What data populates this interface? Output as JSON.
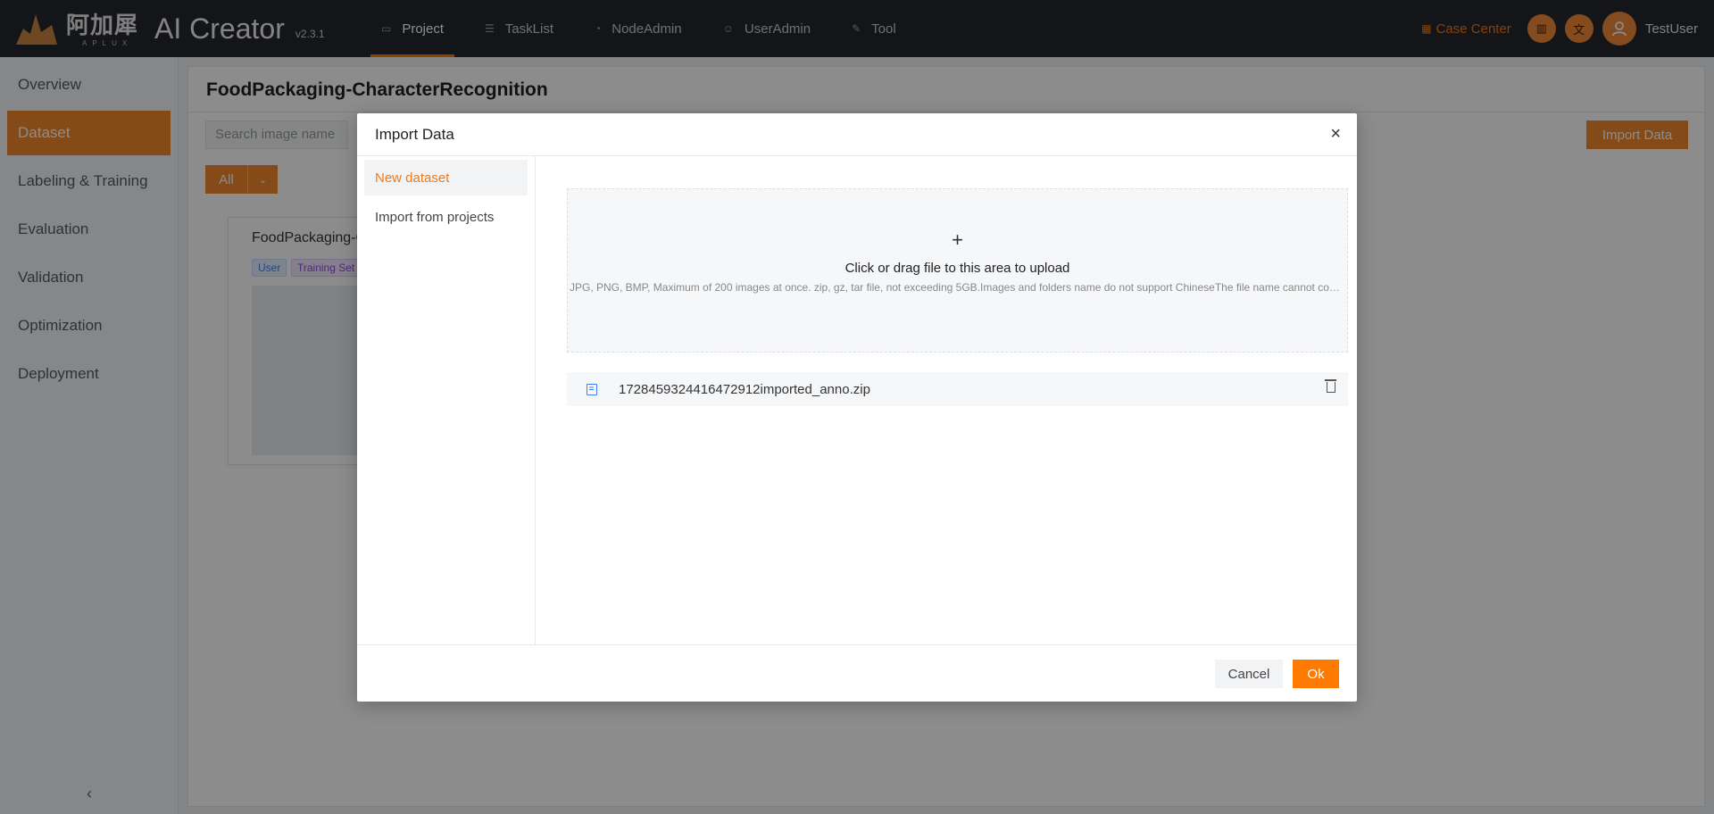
{
  "app": {
    "logo_cn": "阿加犀",
    "logo_sub": "APLUX",
    "title": "AI Creator",
    "version": "v2.3.1"
  },
  "nav": {
    "items": [
      {
        "label": "Project",
        "icon": "folder-icon",
        "active": true
      },
      {
        "label": "TaskList",
        "icon": "list-icon",
        "active": false
      },
      {
        "label": "NodeAdmin",
        "icon": "node-icon",
        "active": false
      },
      {
        "label": "UserAdmin",
        "icon": "users-icon",
        "active": false
      },
      {
        "label": "Tool",
        "icon": "wrench-icon",
        "active": false
      }
    ]
  },
  "topright": {
    "case_center": "Case Center",
    "user_name": "TestUser"
  },
  "sidebar": {
    "items": [
      {
        "label": "Overview",
        "active": false
      },
      {
        "label": "Dataset",
        "active": true
      },
      {
        "label": "Labeling & Training",
        "active": false
      },
      {
        "label": "Evaluation",
        "active": false
      },
      {
        "label": "Validation",
        "active": false
      },
      {
        "label": "Optimization",
        "active": false
      },
      {
        "label": "Deployment",
        "active": false
      }
    ],
    "collapse": "‹"
  },
  "main": {
    "title": "FoodPackaging-CharacterRecognition",
    "search_placeholder": "Search image name",
    "import_label": "Import Data",
    "filter_label": "All",
    "card": {
      "title": "FoodPackaging-C",
      "tag_user": "User",
      "tag_training": "Training Set"
    }
  },
  "modal": {
    "title": "Import Data",
    "close": "×",
    "tabs": [
      {
        "label": "New dataset",
        "active": true
      },
      {
        "label": "Import from projects",
        "active": false
      }
    ],
    "upload_plus": "+",
    "upload_text": "Click or drag file to this area to upload",
    "upload_hint": "JPG, PNG, BMP, Maximum of 200 images at once. zip, gz, tar file, not exceeding 5GB.Images and folders name do not support ChineseThe file name cannot contain spaces",
    "file_name": "1728459324416472912imported_anno.zip",
    "cancel_label": "Cancel",
    "ok_label": "Ok"
  },
  "colors": {
    "accent": "#ff7a00",
    "topbar": "#24272e"
  }
}
